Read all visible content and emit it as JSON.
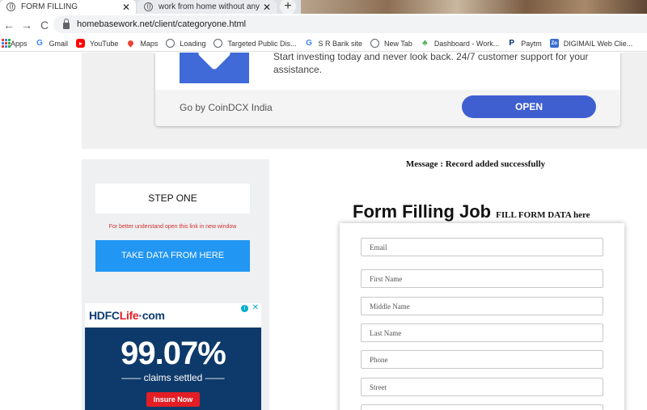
{
  "browser": {
    "tabs": [
      {
        "title": "FORM FILLING",
        "close": "✕"
      },
      {
        "title": "work from home without any inv",
        "close": "✕"
      }
    ],
    "new_tab": "+",
    "nav": {
      "back": "←",
      "forward": "→",
      "reload": "C"
    },
    "url": "homebasework.net/client/categoryone.html",
    "bookmarks": [
      {
        "label": "Apps",
        "icon": "apps-grid-icon"
      },
      {
        "label": "Gmail",
        "icon": "google-icon"
      },
      {
        "label": "YouTube",
        "icon": "youtube-icon"
      },
      {
        "label": "Maps",
        "icon": "maps-pin-icon"
      },
      {
        "label": "Loading",
        "icon": "globe-icon"
      },
      {
        "label": "Targeted Public Dis...",
        "icon": "globe-icon"
      },
      {
        "label": "S R Barik site",
        "icon": "google-icon"
      },
      {
        "label": "New Tab",
        "icon": "globe-icon"
      },
      {
        "label": "Dashboard - Work...",
        "icon": "dashboard-icon"
      },
      {
        "label": "Paytm",
        "icon": "paytm-icon"
      },
      {
        "label": "DIGIMAIL Web Clie...",
        "icon": "digimail-icon"
      }
    ]
  },
  "top_ad": {
    "text": "Start investing today and never look back. 24/7 customer support for your assistance.",
    "brand": "Go by CoinDCX India",
    "cta": "OPEN"
  },
  "sidebar": {
    "step_label": "STEP ONE",
    "note": "For better understand open this link in new window",
    "take_data": "TAKE DATA FROM HERE",
    "ad": {
      "logo_main": "HDFC",
      "logo_accent": "Life",
      "logo_tail": "·com",
      "big": "99.07%",
      "sub": "—— claims settled ——",
      "cta": "Insure Now",
      "adchoice": "i",
      "close": "✕"
    }
  },
  "main": {
    "message": "Message : Record added successfully",
    "title": "Form Filling Job",
    "subtitle": "FILL FORM DATA here",
    "fields": [
      {
        "placeholder": "Email"
      },
      {
        "placeholder": "First Name"
      },
      {
        "placeholder": "Middle Name"
      },
      {
        "placeholder": "Last Name"
      },
      {
        "placeholder": "Phone"
      },
      {
        "placeholder": "Street"
      },
      {
        "placeholder": ""
      }
    ]
  },
  "colors": {
    "open_button": "#3f5fd1",
    "take_data_button": "#2196f3",
    "note_red": "#d32f2f",
    "hdfc_navy": "#0e3a6b"
  }
}
